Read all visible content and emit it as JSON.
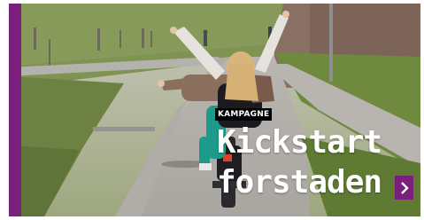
{
  "campaign": {
    "badge": "KAMPAGNE",
    "headline_line1": "Kickstart",
    "headline_line2": "forstaden"
  },
  "colors": {
    "accent": "#7a1f7c",
    "badge_bg": "#000000",
    "headline_text": "#ffffff"
  },
  "icons": {
    "next": "chevron-right-icon"
  }
}
